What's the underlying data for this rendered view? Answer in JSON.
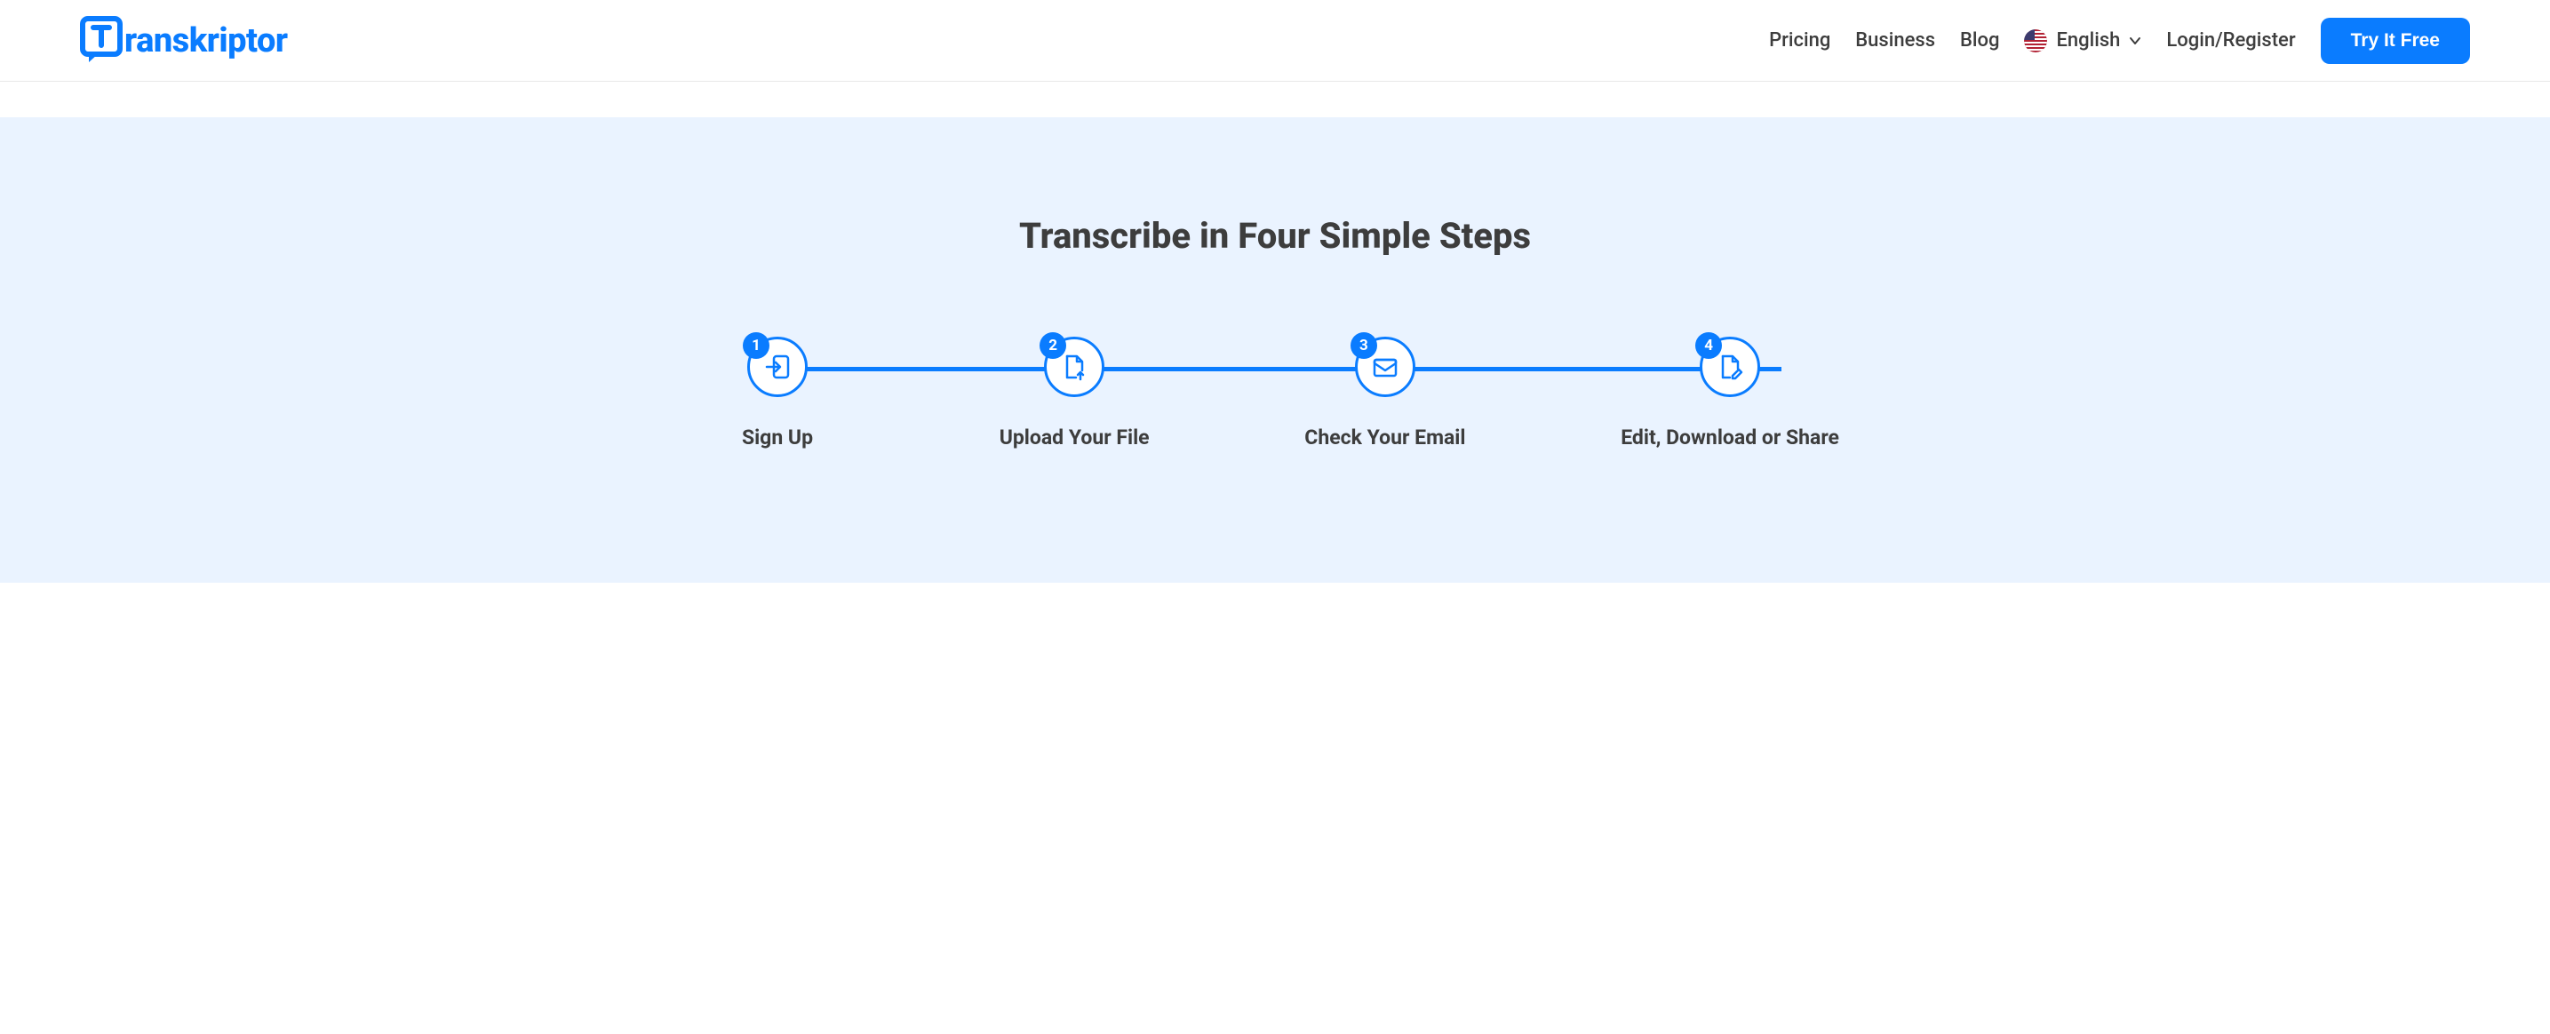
{
  "header": {
    "logo_text": "ranskriptor",
    "nav": {
      "pricing": "Pricing",
      "business": "Business",
      "blog": "Blog",
      "language_label": "English",
      "login": "Login/Register"
    },
    "cta": "Try It Free"
  },
  "steps": {
    "title": "Transcribe in Four Simple Steps",
    "items": [
      {
        "num": "1",
        "label": "Sign Up"
      },
      {
        "num": "2",
        "label": "Upload Your File"
      },
      {
        "num": "3",
        "label": "Check Your Email"
      },
      {
        "num": "4",
        "label": "Edit, Download or Share"
      }
    ]
  }
}
